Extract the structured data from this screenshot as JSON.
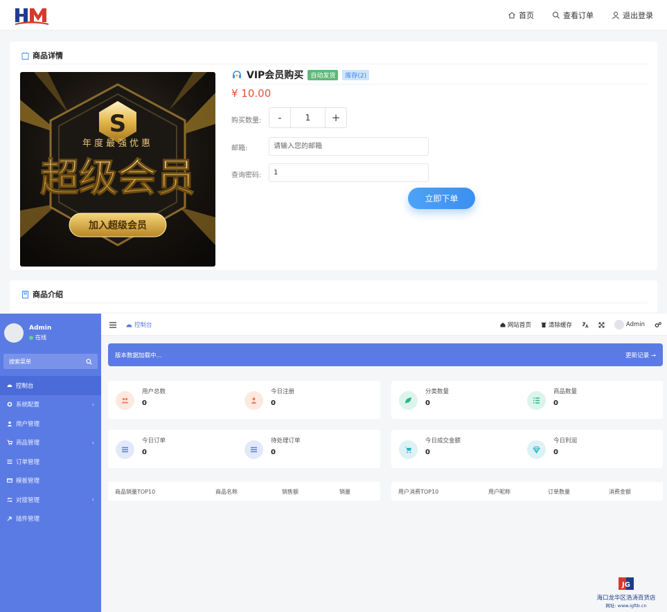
{
  "shop": {
    "nav": {
      "home": "首页",
      "orders": "查看订单",
      "logout": "退出登录"
    },
    "detail": {
      "section_title": "商品详情",
      "banner": {
        "badge_text": "年度最强优惠",
        "headline": "超级会员",
        "cta": "加入超级会员"
      },
      "product_name": "VIP会员购买",
      "tag_auto": "自动发货",
      "tag_stock": "库存(2)",
      "price": "¥ 10.00",
      "quantity_label": "购买数量:",
      "quantity_value": "1",
      "minus": "-",
      "plus": "+",
      "email_label": "邮箱:",
      "email_placeholder": "请输入您的邮箱",
      "password_label": "查询密码:",
      "password_value": "1",
      "order_button": "立即下单"
    },
    "intro": {
      "section_title": "商品介绍"
    }
  },
  "admin": {
    "profile": {
      "name": "Admin",
      "status": "在线"
    },
    "search_label": "搜索菜单",
    "menu": [
      {
        "label": "控制台",
        "active": true,
        "caret": false
      },
      {
        "label": "系统配置",
        "active": false,
        "caret": true
      },
      {
        "label": "用户管理",
        "active": false,
        "caret": false
      },
      {
        "label": "商品管理",
        "active": false,
        "caret": true
      },
      {
        "label": "订单管理",
        "active": false,
        "caret": false
      },
      {
        "label": "模板管理",
        "active": false,
        "caret": false
      },
      {
        "label": "对接管理",
        "active": false,
        "caret": true
      },
      {
        "label": "插件管理",
        "active": false,
        "caret": false
      }
    ],
    "topbar": {
      "tab": "控制台",
      "site_home": "网站首页",
      "clear_cache": "清除缓存",
      "user": "Admin"
    },
    "notice": {
      "text": "版本数据加载中...",
      "link": "更新记录 →"
    },
    "stats": [
      {
        "label": "用户总数",
        "value": "0",
        "icon": "users-icon",
        "color": "#f57c4f",
        "bg": "#fde9df"
      },
      {
        "label": "今日注册",
        "value": "0",
        "icon": "user-icon",
        "color": "#f57c4f",
        "bg": "#fde9df"
      },
      {
        "label": "分类数量",
        "value": "0",
        "icon": "leaf-icon",
        "color": "#2fb488",
        "bg": "#dcf4ec"
      },
      {
        "label": "商品数量",
        "value": "0",
        "icon": "list-icon",
        "color": "#2fb488",
        "bg": "#dcf4ec"
      },
      {
        "label": "今日订单",
        "value": "0",
        "icon": "orders-icon",
        "color": "#5b7be4",
        "bg": "#e3e9fb"
      },
      {
        "label": "待处理订单",
        "value": "0",
        "icon": "pending-icon",
        "color": "#5b7be4",
        "bg": "#e3e9fb"
      },
      {
        "label": "今日成交金额",
        "value": "0",
        "icon": "cart-icon",
        "color": "#26b3c4",
        "bg": "#dcf2f5"
      },
      {
        "label": "今日利润",
        "value": "0",
        "icon": "diamond-icon",
        "color": "#26b3c4",
        "bg": "#dcf2f5"
      }
    ],
    "tables": {
      "left": [
        "商品销量TOP10",
        "商品名称",
        "销售额",
        "销量"
      ],
      "right": [
        "用户消费TOP10",
        "用户昵称",
        "订单数量",
        "消费金额"
      ]
    }
  },
  "watermark": {
    "name": "海口龙华区浩涛百货店",
    "url": "网址: www.igftb.cn"
  },
  "colors": {
    "primary": "#5b7be4",
    "price": "#e2513b",
    "order_button": "#3b8ff1"
  }
}
